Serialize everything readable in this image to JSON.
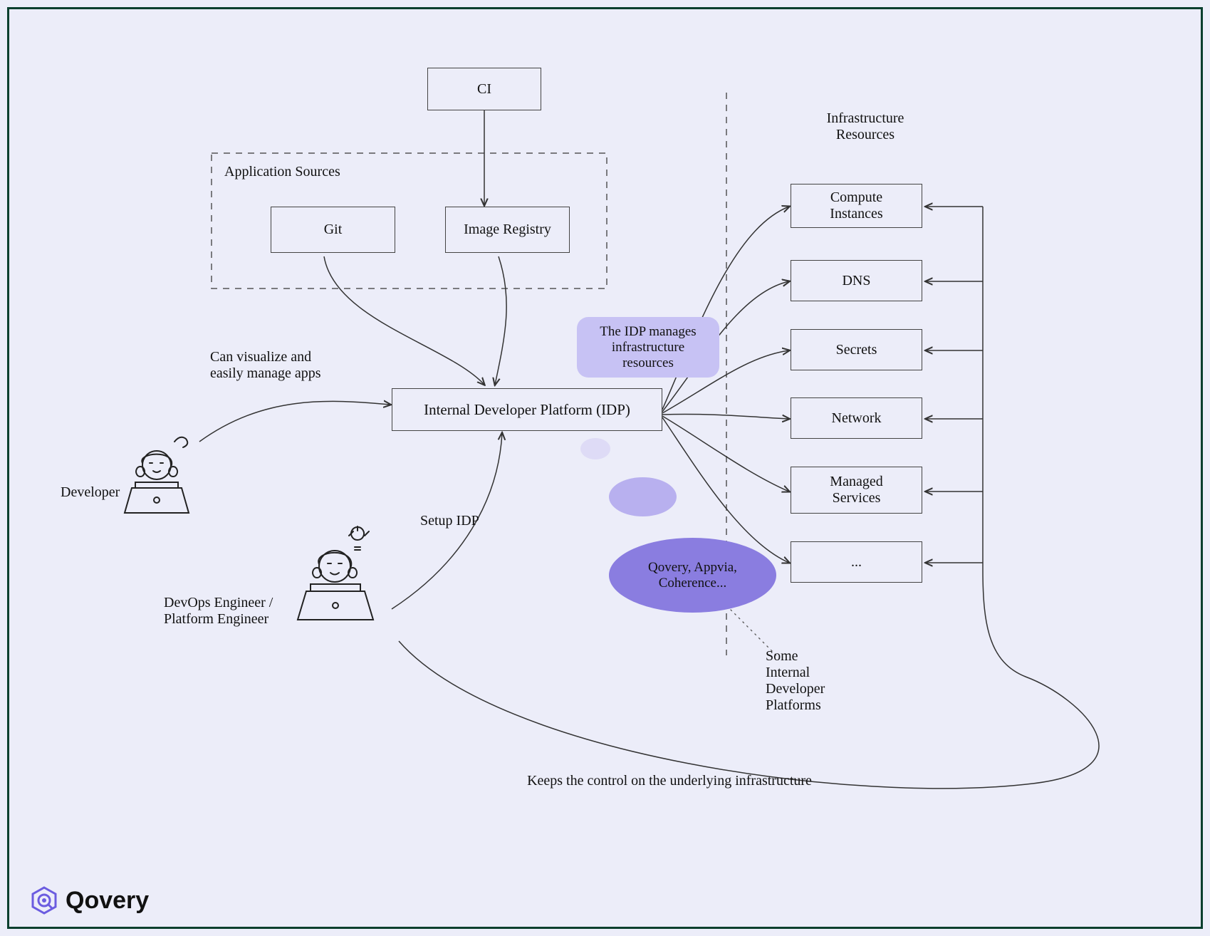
{
  "nodes": {
    "ci": "CI",
    "app_sources_title": "Application Sources",
    "git": "Git",
    "image_registry": "Image Registry",
    "idp": "Internal Developer Platform (IDP)",
    "developer": "Developer",
    "devops": "DevOps Engineer /\nPlatform Engineer",
    "infra_title": "Infrastructure\nResources",
    "resources": {
      "compute": "Compute\nInstances",
      "dns": "DNS",
      "secrets": "Secrets",
      "network": "Network",
      "managed": "Managed\nServices",
      "more": "..."
    }
  },
  "annotations": {
    "visualize": "Can visualize and\neasily manage apps",
    "setup_idp": "Setup IDP",
    "keeps_control": "Keeps the control on the underlying infrastructure",
    "idp_manages": "The IDP manages\ninfrastructure\nresources",
    "providers": "Qovery, Appvia,\nCoherence...",
    "providers_note": "Some\nInternal\nDeveloper\nPlatforms"
  },
  "brand": "Qovery",
  "colors": {
    "bubble": "#c7c2f4",
    "ellipse_dark": "#8a7de0",
    "ellipse_mid": "#b8b0ef",
    "ellipse_light": "#dedbf6"
  }
}
